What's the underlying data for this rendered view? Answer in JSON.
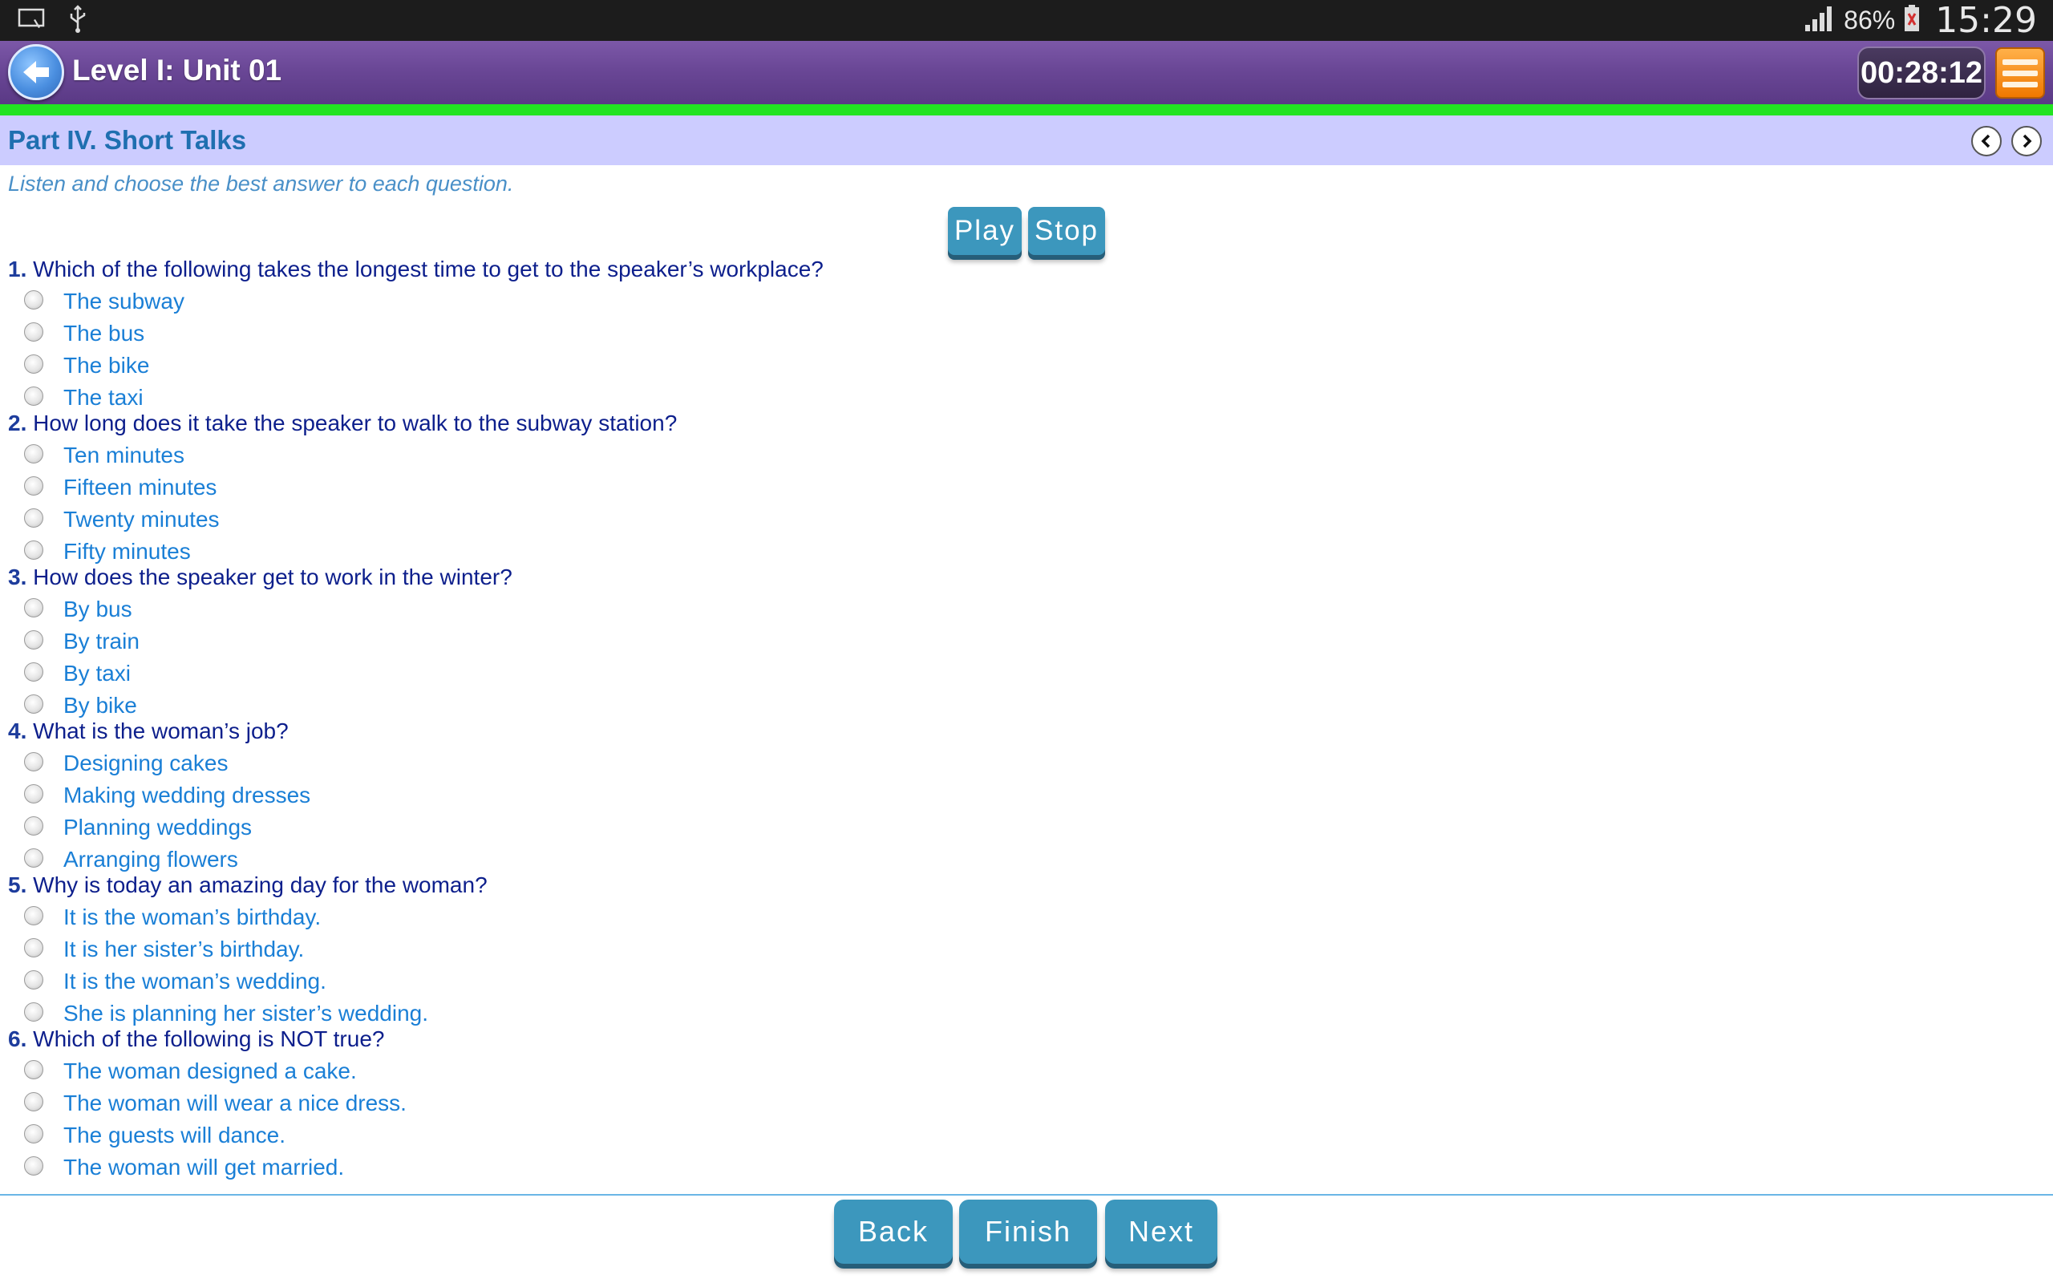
{
  "status_bar": {
    "battery_percent": "86%",
    "time": "15:29"
  },
  "header": {
    "title": "Level I: Unit 01",
    "timer": "00:28:12"
  },
  "section": {
    "title": "Part IV. Short Talks",
    "instructions": "Listen and choose the best answer to each question."
  },
  "audio": {
    "play_label": "Play",
    "stop_label": "Stop"
  },
  "questions": [
    {
      "number": "1.",
      "text": "Which of the following takes the longest time to get to the speaker’s workplace?",
      "options": [
        "The subway",
        "The bus",
        "The bike",
        "The taxi"
      ]
    },
    {
      "number": "2.",
      "text": "How long does it take the speaker to walk to the subway station?",
      "options": [
        "Ten minutes",
        "Fifteen minutes",
        "Twenty minutes",
        "Fifty minutes"
      ]
    },
    {
      "number": "3.",
      "text": "How does the speaker get to work in the winter?",
      "options": [
        "By bus",
        "By train",
        "By taxi",
        "By bike"
      ]
    },
    {
      "number": "4.",
      "text": "What is the woman’s job?",
      "options": [
        "Designing cakes",
        "Making wedding dresses",
        "Planning weddings",
        "Arranging flowers"
      ]
    },
    {
      "number": "5.",
      "text": "Why is today an amazing day for the woman?",
      "options": [
        "It is the woman’s birthday.",
        "It is her sister’s birthday.",
        "It is the woman’s wedding.",
        "She is planning her sister’s wedding."
      ]
    },
    {
      "number": "6.",
      "text": "Which of the following is NOT true?",
      "options": [
        "The woman designed a cake.",
        "The woman will wear a nice dress.",
        "The guests will dance.",
        "The woman will get married."
      ]
    }
  ],
  "footer": {
    "back_label": "Back",
    "finish_label": "Finish",
    "next_label": "Next"
  },
  "colors": {
    "header_purple": "#6a4796",
    "section_bar": "#ccccff",
    "button_blue": "#3c97bd",
    "progress_green": "#22e322",
    "timer_menu_orange": "#f07800"
  },
  "icons": {
    "cast": "cast-icon",
    "usb": "usb-icon",
    "signal": "signal-icon",
    "battery": "battery-icon",
    "back": "back-arrow-icon",
    "menu": "hamburger-menu-icon",
    "prev": "chevron-left-icon",
    "next": "chevron-right-icon"
  }
}
